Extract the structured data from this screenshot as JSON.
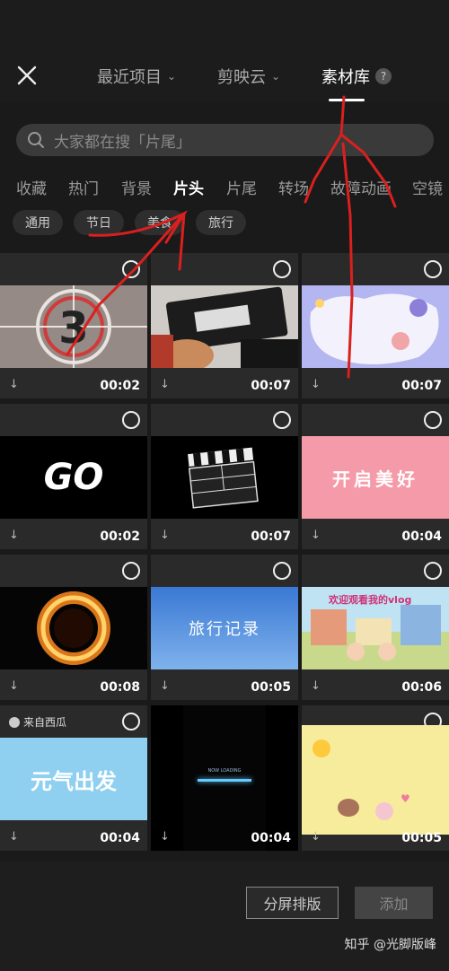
{
  "header": {
    "tabs": [
      {
        "label": "最近项目",
        "chevron": "chevron-down"
      },
      {
        "label": "剪映云",
        "chevron": "chevron-down"
      },
      {
        "label": "素材库"
      }
    ],
    "help_label": "?"
  },
  "search": {
    "placeholder": "大家都在搜「片尾」"
  },
  "categories": [
    "收藏",
    "热门",
    "背景",
    "片头",
    "片尾",
    "转场",
    "故障动画",
    "空镜"
  ],
  "chips": [
    "通用",
    "节日",
    "美食",
    "旅行"
  ],
  "items": [
    {
      "duration": "00:02"
    },
    {
      "duration": "00:07"
    },
    {
      "duration": "00:07"
    },
    {
      "duration": "00:02"
    },
    {
      "duration": "00:07"
    },
    {
      "duration": "00:04"
    },
    {
      "duration": "00:08"
    },
    {
      "duration": "00:05"
    },
    {
      "duration": "00:06"
    },
    {
      "duration": "00:04",
      "source": "来自西瓜"
    },
    {
      "duration": "00:04"
    },
    {
      "duration": "00:05"
    }
  ],
  "thumb_text": {
    "go": "GO",
    "open_good": "开启美好",
    "travel": "旅行记录",
    "vlog": "欢迎观看我的vlog",
    "yuanqi": "元气出发",
    "loading": "NOW LOADING"
  },
  "bottom": {
    "split_label": "分屏排版",
    "add_label": "添加",
    "watermark": "知乎 @光脚版峰"
  },
  "colors": {
    "accent_red": "#d9201e",
    "bg": "#1a1a1a"
  }
}
